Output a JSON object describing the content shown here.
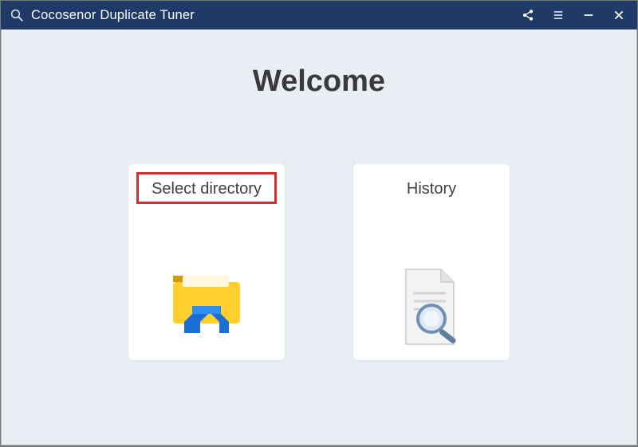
{
  "titlebar": {
    "app_name": "Cocosenor Duplicate Tuner"
  },
  "main": {
    "heading": "Welcome",
    "cards": {
      "select_directory": {
        "label": "Select directory",
        "highlighted": true
      },
      "history": {
        "label": "History",
        "highlighted": false
      }
    }
  },
  "colors": {
    "titlebar_bg": "#203a67",
    "body_bg": "#e9edf4",
    "highlight": "#d92c2c"
  }
}
